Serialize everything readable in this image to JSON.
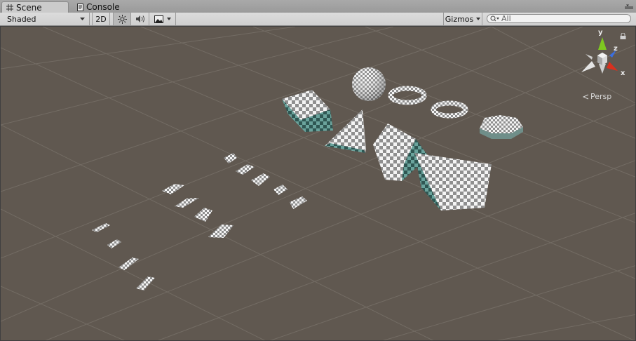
{
  "tabs": [
    {
      "label": "Scene",
      "icon": "grid-icon",
      "active": true
    },
    {
      "label": "Console",
      "icon": "console-icon",
      "active": false
    }
  ],
  "toolbar": {
    "draw_mode": "Shaded",
    "mode_2d_label": "2D",
    "gizmos_label": "Gizmos",
    "search_placeholder": "All"
  },
  "viewport": {
    "projection_label": "Persp",
    "axes": {
      "x": "x",
      "y": "y",
      "z": "z"
    },
    "background_color": "#605850",
    "axis_colors": {
      "x": "#d9301e",
      "y": "#7ec820",
      "z": "#3a6ee0"
    }
  }
}
